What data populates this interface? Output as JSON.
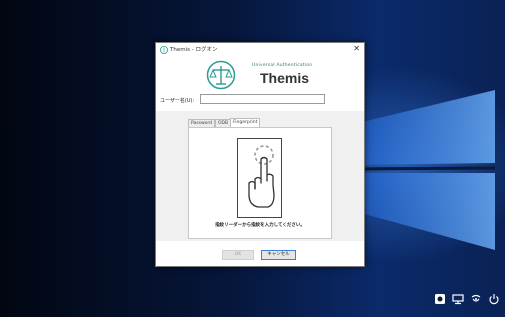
{
  "dialog": {
    "title": "Themis - ログオン",
    "close_glyph": "✕",
    "brand_subtitle": "Universal Authentication",
    "brand_name": "Themis",
    "username_label": "ユーザー名(U):",
    "username_value": "",
    "tabs": [
      {
        "label": "Password",
        "active": false
      },
      {
        "label": "ODB",
        "active": false
      },
      {
        "label": "Fingerprint",
        "active": true
      }
    ],
    "instruction": "指紋リーダーから指紋を入力してください。",
    "ok_label": "OK",
    "cancel_label": "キャンセル"
  },
  "tray": {
    "icons": [
      "accessibility-icon",
      "network-icon",
      "ease-of-access-icon",
      "power-icon"
    ]
  },
  "colors": {
    "accent": "#2a9d8f",
    "button_focus": "#3c7fd6"
  }
}
